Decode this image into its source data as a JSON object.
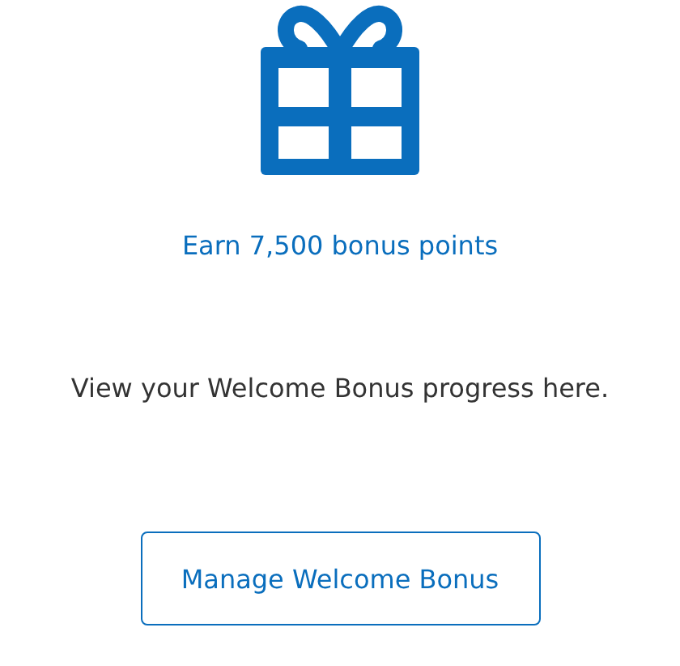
{
  "offer": {
    "headline": "Earn 7,500 bonus points",
    "description": "View your Welcome Bonus progress here.",
    "button": "Manage Welcome Bonus"
  }
}
